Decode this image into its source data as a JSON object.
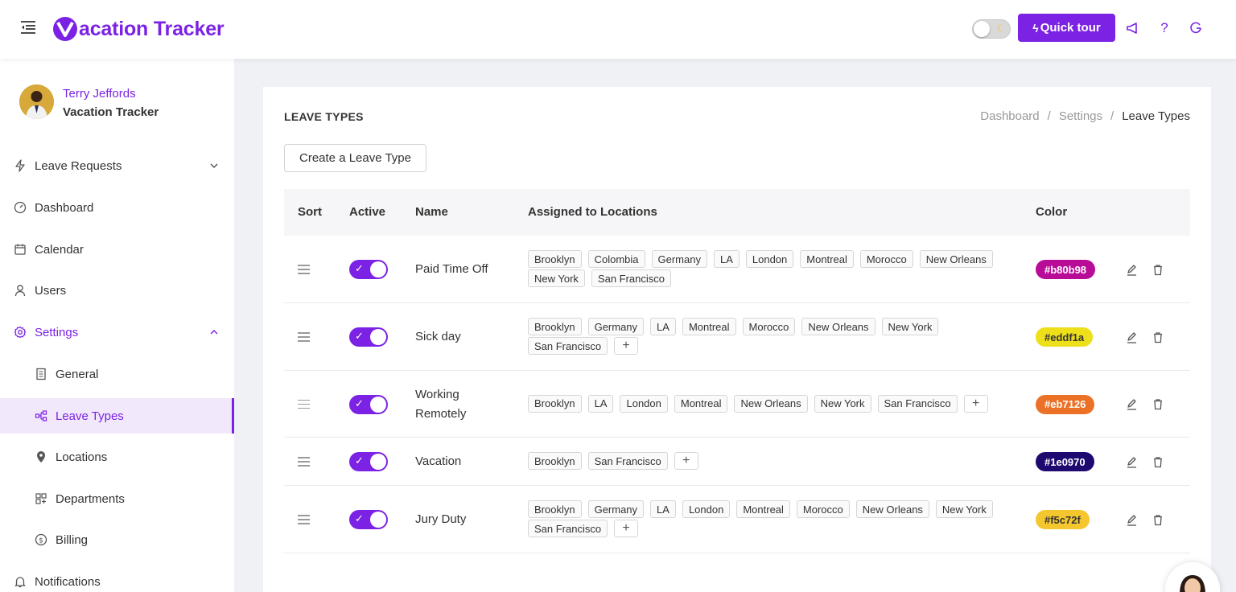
{
  "header": {
    "app_name": "Vacation Tracker",
    "app_name_rest": "acation Tracker",
    "quick_tour_label": "Quick tour"
  },
  "user": {
    "name": "Terry Jeffords",
    "company": "Vacation Tracker"
  },
  "sidebar": {
    "items": [
      {
        "label": "Leave Requests",
        "icon": "bolt-icon"
      },
      {
        "label": "Dashboard",
        "icon": "dashboard-icon"
      },
      {
        "label": "Calendar",
        "icon": "calendar-icon"
      },
      {
        "label": "Users",
        "icon": "user-icon"
      },
      {
        "label": "Settings",
        "icon": "gear-icon"
      },
      {
        "label": "General",
        "icon": "document-icon"
      },
      {
        "label": "Leave Types",
        "icon": "hierarchy-icon"
      },
      {
        "label": "Locations",
        "icon": "location-pin-icon"
      },
      {
        "label": "Departments",
        "icon": "departments-icon"
      },
      {
        "label": "Billing",
        "icon": "dollar-icon"
      },
      {
        "label": "Notifications",
        "icon": "bell-icon"
      }
    ]
  },
  "page": {
    "title": "LEAVE TYPES",
    "breadcrumb": [
      "Dashboard",
      "Settings",
      "Leave Types"
    ],
    "create_button": "Create a Leave Type"
  },
  "table": {
    "columns": [
      "Sort",
      "Active",
      "Name",
      "Assigned to Locations",
      "Color"
    ],
    "rows": [
      {
        "name": "Paid Time Off",
        "active": true,
        "locations": [
          "Brooklyn",
          "Colombia",
          "Germany",
          "LA",
          "London",
          "Montreal",
          "Morocco",
          "New Orleans",
          "New York",
          "San Francisco"
        ],
        "has_add": false,
        "color": "#b80b98",
        "color_text": "#b80b98"
      },
      {
        "name": "Sick day",
        "active": true,
        "locations": [
          "Brooklyn",
          "Germany",
          "LA",
          "Montreal",
          "Morocco",
          "New Orleans",
          "New York",
          "San Francisco"
        ],
        "has_add": true,
        "color": "#eddf1a",
        "color_text": "#eddf1a"
      },
      {
        "name": "Working Remotely",
        "active": true,
        "locations": [
          "Brooklyn",
          "LA",
          "London",
          "Montreal",
          "New Orleans",
          "New York",
          "San Francisco"
        ],
        "has_add": true,
        "color": "#eb7126",
        "color_text": "#eb7126"
      },
      {
        "name": "Vacation",
        "active": true,
        "locations": [
          "Brooklyn",
          "San Francisco"
        ],
        "has_add": true,
        "color": "#1e0970",
        "color_text": "#1e0970"
      },
      {
        "name": "Jury Duty",
        "active": true,
        "locations": [
          "Brooklyn",
          "Germany",
          "LA",
          "London",
          "Montreal",
          "Morocco",
          "New Orleans",
          "New York",
          "San Francisco"
        ],
        "has_add": true,
        "color": "#f5c72f",
        "color_text": "#f5c72f"
      }
    ]
  },
  "colors": {
    "accent": "#7b22e4",
    "selected_bg": "#f1e8fc"
  }
}
